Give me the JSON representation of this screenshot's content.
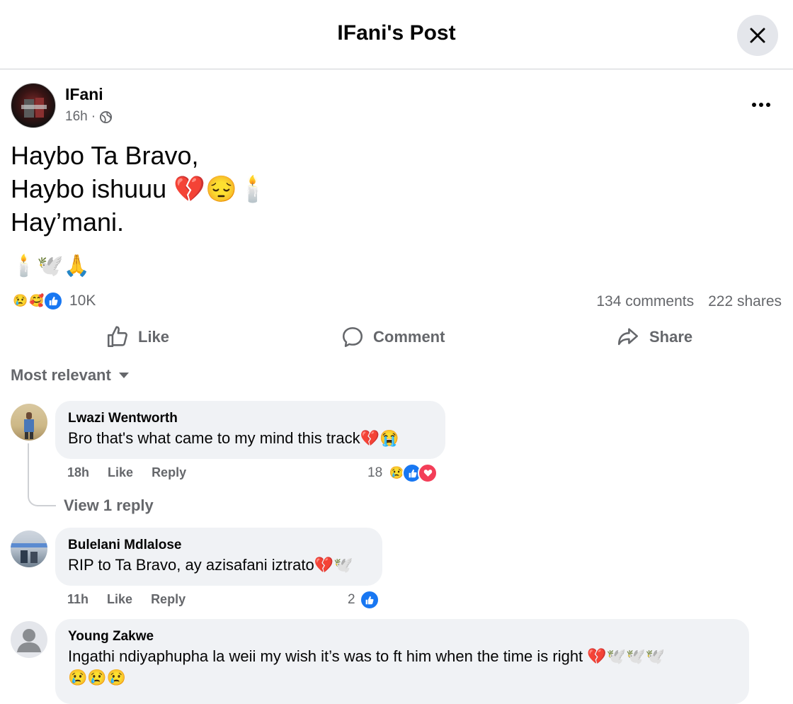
{
  "header": {
    "title": "IFani's Post"
  },
  "post": {
    "author": "IFani",
    "time": "16h",
    "separator": "·",
    "lines": [
      "Haybo Ta Bravo,",
      "Haybo ishuuu 💔😔🕯️",
      "Hay’mani."
    ],
    "emoji_line": "🕯️🕊️🙏",
    "reaction_count": "10K",
    "comments_count": "134 comments",
    "shares_count": "222 shares"
  },
  "actions": {
    "like": "Like",
    "comment": "Comment",
    "share": "Share"
  },
  "sort_label": "Most relevant",
  "comments": [
    {
      "name": "Lwazi Wentworth",
      "text": "Bro that's what came to my mind this track💔😭",
      "time": "18h",
      "like": "Like",
      "reply": "Reply",
      "reaction_count": "18",
      "view_replies": "View 1 reply"
    },
    {
      "name": "Bulelani Mdlalose",
      "text": "RIP to Ta Bravo, ay azisafani iztrato💔🕊️",
      "time": "11h",
      "like": "Like",
      "reply": "Reply",
      "reaction_count": "2"
    },
    {
      "name": "Young Zakwe",
      "text": "Ingathi ndiyaphupha la weii my wish it’s was to ft him when the time is right 💔🕊️🕊️🕊️",
      "text2": "😢😢😢"
    }
  ],
  "colors": {
    "accent": "#1877f2",
    "secondary_text": "#65676b",
    "bubble": "#f0f2f5"
  }
}
